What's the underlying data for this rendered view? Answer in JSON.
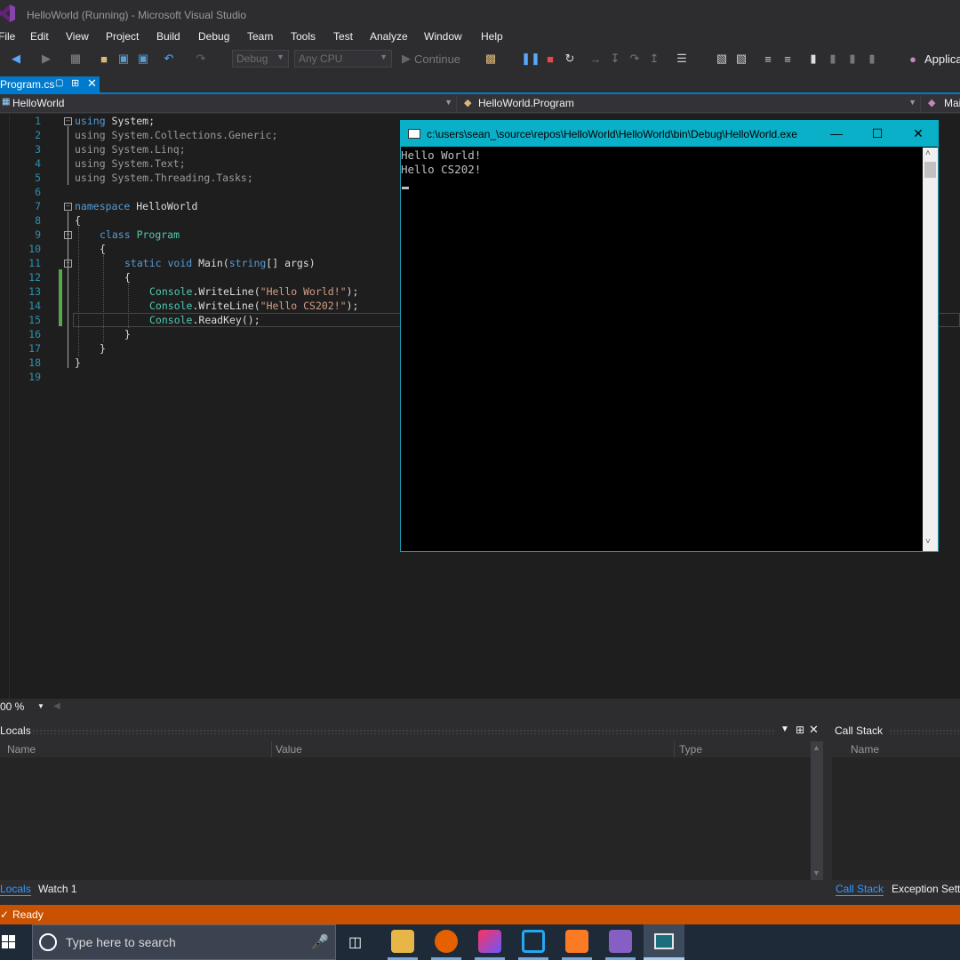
{
  "window": {
    "title": "HelloWorld (Running) - Microsoft Visual Studio"
  },
  "menu": [
    "File",
    "Edit",
    "View",
    "Project",
    "Build",
    "Debug",
    "Team",
    "Tools",
    "Test",
    "Analyze",
    "Window",
    "Help"
  ],
  "toolbar": {
    "config": "Debug",
    "platform": "Any CPU",
    "continue_label": "Continue",
    "app_insights": "Applica"
  },
  "tab": {
    "filename": "Program.cs"
  },
  "nav": {
    "project": "HelloWorld",
    "class": "HelloWorld.Program",
    "member": "Mai"
  },
  "code": {
    "line_numbers": [
      "1",
      "2",
      "3",
      "4",
      "5",
      "6",
      "7",
      "8",
      "9",
      "10",
      "11",
      "12",
      "13",
      "14",
      "15",
      "16",
      "17",
      "18",
      "19"
    ],
    "l1_kw": "using",
    "l1_rest": " System;",
    "l2": "using System.Collections.Generic;",
    "l3": "using System.Linq;",
    "l4": "using System.Text;",
    "l5": "using System.Threading.Tasks;",
    "l7_kw": "namespace",
    "l7_rest": " HelloWorld",
    "open_brace": "{",
    "close_brace": "}",
    "l9_kw": "class",
    "l9_ty": "Program",
    "l11_kw1": "static",
    "l11_kw2": "void",
    "l11_mid": "Main(",
    "l11_kw3": "string",
    "l11_end": "[] args)",
    "console": "Console",
    "writeline": ".WriteLine(",
    "l13_str": "\"Hello World!\"",
    "l14_str": "\"Hello CS202!\"",
    "call_end": ");",
    "readkey": ".ReadKey();"
  },
  "console": {
    "title": "c:\\users\\sean_\\source\\repos\\HelloWorld\\HelloWorld\\bin\\Debug\\HelloWorld.exe",
    "lines": [
      "Hello World!",
      "Hello CS202!"
    ]
  },
  "zoom": "00 %",
  "locals": {
    "title": "Locals",
    "columns": [
      "Name",
      "Value",
      "Type"
    ]
  },
  "callstack": {
    "title": "Call Stack",
    "columns": [
      "Name"
    ]
  },
  "bottom_tabs": {
    "left": [
      "Locals",
      "Watch 1"
    ],
    "right": [
      "Call Stack",
      "Exception Setti"
    ]
  },
  "status": "Ready",
  "taskbar": {
    "search_placeholder": "Type here to search"
  },
  "colors": {
    "accent": "#007acc",
    "status": "#ca5100",
    "console_title": "#0ab0c8"
  }
}
